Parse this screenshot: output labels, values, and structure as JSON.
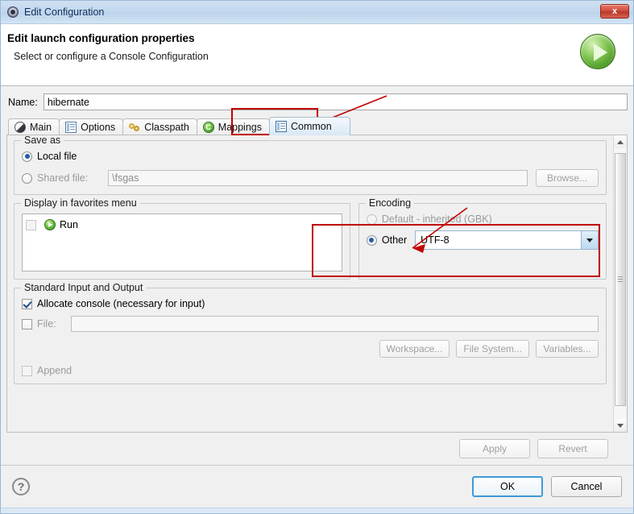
{
  "window": {
    "title": "Edit Configuration",
    "title_icon": "gear-icon",
    "close_label": "x"
  },
  "header": {
    "title": "Edit launch configuration properties",
    "subtitle": "Select or configure a Console Configuration",
    "icon": "run-play-icon"
  },
  "name_field": {
    "label": "Name:",
    "value": "hibernate",
    "placeholder": ""
  },
  "tabs": [
    {
      "label": "Main",
      "icon": "main-sphere-icon",
      "active": false
    },
    {
      "label": "Options",
      "icon": "options-list-icon",
      "active": false
    },
    {
      "label": "Classpath",
      "icon": "classpath-links-icon",
      "active": false
    },
    {
      "label": "Mappings",
      "icon": "mappings-c-icon",
      "active": false
    },
    {
      "label": "Common",
      "icon": "common-list-icon",
      "active": true
    }
  ],
  "save_as": {
    "group_label": "Save as",
    "local_file": {
      "label": "Local file",
      "selected": true
    },
    "shared_file": {
      "label": "Shared file:",
      "selected": false,
      "value": "\\fsgas"
    },
    "browse_button": {
      "label": "Browse...",
      "enabled": false
    }
  },
  "favorites": {
    "group_label": "Display in favorites menu",
    "items": [
      {
        "label": "Run",
        "icon": "run-play-icon",
        "checked": false
      }
    ]
  },
  "encoding": {
    "group_label": "Encoding",
    "default_option": {
      "label": "Default - inherited (GBK)",
      "selected": false
    },
    "other_option": {
      "label": "Other",
      "selected": true
    },
    "other_value": "UTF-8",
    "dropdown_icon": "chevron-down-icon"
  },
  "standard_io": {
    "group_label": "Standard Input and Output",
    "allocate_console": {
      "label": "Allocate console (necessary for input)",
      "checked": true
    },
    "file_row": {
      "label": "File:",
      "checked": false,
      "value": ""
    },
    "buttons": [
      {
        "label": "Workspace...",
        "enabled": false
      },
      {
        "label": "File System...",
        "enabled": false
      },
      {
        "label": "Variables...",
        "enabled": false
      }
    ],
    "append": {
      "label": "Append",
      "checked": false
    }
  },
  "action_buttons": {
    "apply": {
      "label": "Apply",
      "enabled": false
    },
    "revert": {
      "label": "Revert",
      "enabled": false
    }
  },
  "footer": {
    "help_label": "?",
    "ok": {
      "label": "OK",
      "default": true
    },
    "cancel": {
      "label": "Cancel",
      "default": false
    }
  },
  "annotations": {
    "accent_color": "#c00000",
    "marks": [
      {
        "name": "common-tab-highlight",
        "type": "box-with-arrow"
      },
      {
        "name": "encoding-other-highlight",
        "type": "box-with-arrow"
      }
    ]
  },
  "scrollbar": {
    "up_icon": "scroll-up-icon",
    "down_icon": "scroll-down-icon"
  }
}
